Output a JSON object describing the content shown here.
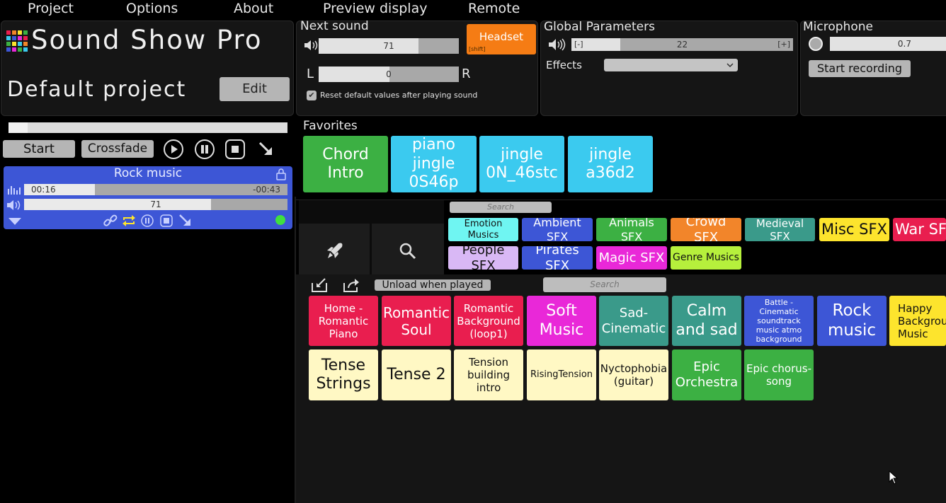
{
  "menu": {
    "items": [
      "Project",
      "Options",
      "About",
      "Preview display",
      "Remote"
    ]
  },
  "app": {
    "title": "Sound Show Pro",
    "project_name": "Default project",
    "edit_label": "Edit"
  },
  "transport": {
    "start_label": "Start",
    "crossfade_label": "Crossfade"
  },
  "now_playing": {
    "title": "Rock music",
    "elapsed": "00:16",
    "remaining": "-00:43",
    "progress": 0.27,
    "volume": "71",
    "volume_level": 0.71
  },
  "next_sound": {
    "label": "Next sound",
    "volume": "71",
    "volume_level": 0.71,
    "pan": "0",
    "pan_left": "L",
    "pan_right": "R",
    "headset_label": "Headset",
    "headset_hint": "[shift]",
    "reset_label": "Reset default values after playing sound"
  },
  "global": {
    "label": "Global Parameters",
    "minus": "[-]",
    "plus": "[+]",
    "volume": "22",
    "volume_level": 0.22,
    "effects_label": "Effects",
    "effects_value": ""
  },
  "microphone": {
    "label": "Microphone",
    "level": "0.7",
    "record_label": "Start recording"
  },
  "favorites": {
    "label": "Favorites",
    "items": [
      {
        "label": "Chord Intro",
        "color": "#3cb043"
      },
      {
        "label": "piano jingle 0S46p",
        "color": "#3bcaef"
      },
      {
        "label": "jingle 0N_46stc",
        "color": "#3bcaef"
      },
      {
        "label": "jingle a36d2",
        "color": "#3bcaef"
      }
    ]
  },
  "categories": {
    "search_placeholder": "Search",
    "items": [
      {
        "label": "Emotion Musics",
        "color": "#6ff5f2"
      },
      {
        "label": "Ambient SFX",
        "color": "#3d56d6"
      },
      {
        "label": "Animals SFX",
        "color": "#3cb043"
      },
      {
        "label": "Crowd SFX",
        "color": "#f2852a"
      },
      {
        "label": "Medieval SFX",
        "color": "#3a9a8a"
      },
      {
        "label": "Misc SFX",
        "color": "#fde42d"
      },
      {
        "label": "War SFX",
        "color": "#e91e4f"
      },
      {
        "label": "People SFX",
        "color": "#d9b8f5"
      },
      {
        "label": "Pirates SFX",
        "color": "#3d56d6"
      },
      {
        "label": "Magic SFX",
        "color": "#e928d8"
      },
      {
        "label": "Genre Musics",
        "color": "#b6f03c"
      }
    ]
  },
  "sounds": {
    "unload_label": "Unload when played",
    "search_placeholder": "Search",
    "items": [
      {
        "label": "Home - Romantic Piano",
        "color": "#e91e4f"
      },
      {
        "label": "Romantic Soul",
        "color": "#e91e4f"
      },
      {
        "label": "Romantic Background (loop1)",
        "color": "#e91e4f"
      },
      {
        "label": "Soft Music",
        "color": "#e928d8"
      },
      {
        "label": "Sad-Cinematic",
        "color": "#3a9a8a"
      },
      {
        "label": "Calm and sad",
        "color": "#3a9a8a"
      },
      {
        "label": "Battle - Cinematic soundtrack music atmo background",
        "color": "#3d56d6"
      },
      {
        "label": "Rock music",
        "color": "#3d56d6"
      },
      {
        "label": "Happy Background Music",
        "color": "#fde42d"
      },
      {
        "label": "Tense Strings",
        "color": "#fff8c4"
      },
      {
        "label": "Tense 2",
        "color": "#fff8c4"
      },
      {
        "label": "Tension building intro",
        "color": "#fff8c4"
      },
      {
        "label": "RisingTension",
        "color": "#fff8c4"
      },
      {
        "label": "Nyctophobia (guitar)",
        "color": "#fff8c4"
      },
      {
        "label": "Epic Orchestra",
        "color": "#3cb043"
      },
      {
        "label": "Epic chorus-song",
        "color": "#3cb043"
      }
    ]
  }
}
